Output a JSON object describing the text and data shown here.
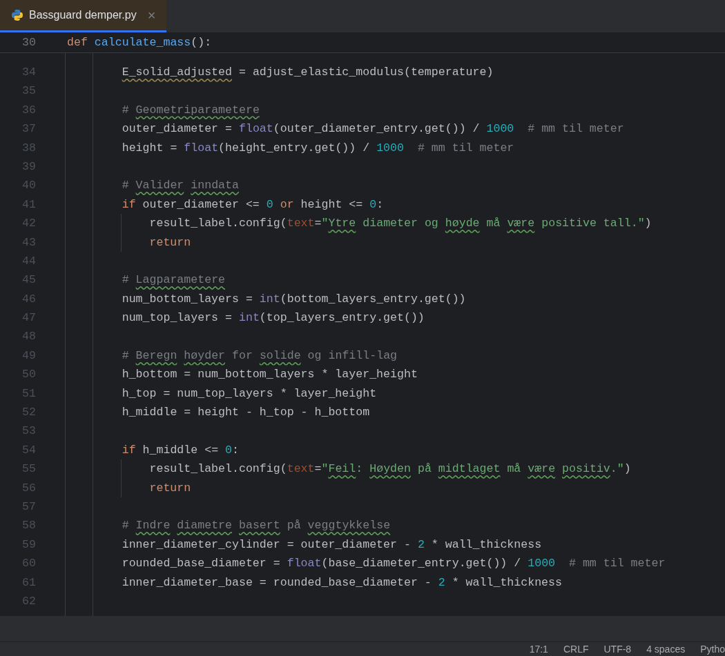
{
  "tabs": [
    {
      "label": "Bassguard demper.py",
      "close": "×",
      "selected": true
    }
  ],
  "sticky_header": {
    "number": "30",
    "tokens": [
      {
        "kind": "kw",
        "text": "def "
      },
      {
        "kind": "fn",
        "text": "calculate_mass"
      },
      {
        "kind": "plain",
        "text": "():"
      }
    ]
  },
  "lines": [
    {
      "number": "34",
      "tokens": [
        {
          "kind": "plain-warn",
          "text": "        E_solid_adjusted"
        },
        {
          "kind": "plain",
          "text": " = adjust_elastic_modulus(temperature)"
        }
      ]
    },
    {
      "number": "35"
    },
    {
      "number": "36",
      "tokens": [
        {
          "kind": "cmt",
          "text": "        # "
        },
        {
          "kind": "cmt-typo",
          "text": "Geometriparametere"
        }
      ]
    },
    {
      "number": "37",
      "tokens": [
        {
          "kind": "plain",
          "text": "        outer_diameter = "
        },
        {
          "kind": "builtin",
          "text": "float"
        },
        {
          "kind": "plain",
          "text": "(outer_diameter_entry.get()) / "
        },
        {
          "kind": "num",
          "text": "1000"
        },
        {
          "kind": "cmt",
          "text": "  # mm til meter"
        }
      ]
    },
    {
      "number": "38",
      "tokens": [
        {
          "kind": "plain",
          "text": "        height = "
        },
        {
          "kind": "builtin",
          "text": "float"
        },
        {
          "kind": "plain",
          "text": "(height_entry.get()) / "
        },
        {
          "kind": "num",
          "text": "1000"
        },
        {
          "kind": "cmt",
          "text": "  # mm til meter"
        }
      ]
    },
    {
      "number": "39"
    },
    {
      "number": "40",
      "tokens": [
        {
          "kind": "cmt",
          "text": "        # "
        },
        {
          "kind": "cmt-typo",
          "text": "Valider"
        },
        {
          "kind": "cmt-typo",
          "text": " inndata"
        }
      ]
    },
    {
      "number": "41",
      "tokens": [
        {
          "kind": "kw",
          "text": "        if "
        },
        {
          "kind": "plain",
          "text": "outer_diameter <= "
        },
        {
          "kind": "num",
          "text": "0"
        },
        {
          "kind": "kw",
          "text": " or "
        },
        {
          "kind": "plain",
          "text": "height <= "
        },
        {
          "kind": "num",
          "text": "0"
        },
        {
          "kind": "plain",
          "text": ":"
        }
      ]
    },
    {
      "number": "42",
      "tokens": [
        {
          "kind": "plain",
          "text": "            result_label.config("
        },
        {
          "kind": "param",
          "text": "text"
        },
        {
          "kind": "plain",
          "text": "="
        },
        {
          "kind": "str",
          "text": "\""
        },
        {
          "kind": "str-typo",
          "text": "Ytre"
        },
        {
          "kind": "str",
          "text": " diameter og "
        },
        {
          "kind": "str-typo",
          "text": "høyde"
        },
        {
          "kind": "str",
          "text": " må "
        },
        {
          "kind": "str-typo",
          "text": "være"
        },
        {
          "kind": "str",
          "text": " positive tall.\""
        },
        {
          "kind": "plain",
          "text": ")"
        }
      ]
    },
    {
      "number": "43",
      "tokens": [
        {
          "kind": "kw",
          "text": "            return"
        }
      ]
    },
    {
      "number": "44"
    },
    {
      "number": "45",
      "tokens": [
        {
          "kind": "cmt",
          "text": "        # "
        },
        {
          "kind": "cmt-typo",
          "text": "Lagparametere"
        }
      ]
    },
    {
      "number": "46",
      "tokens": [
        {
          "kind": "plain",
          "text": "        num_bottom_layers = "
        },
        {
          "kind": "builtin",
          "text": "int"
        },
        {
          "kind": "plain",
          "text": "(bottom_layers_entry.get())"
        }
      ]
    },
    {
      "number": "47",
      "tokens": [
        {
          "kind": "plain",
          "text": "        num_top_layers = "
        },
        {
          "kind": "builtin",
          "text": "int"
        },
        {
          "kind": "plain",
          "text": "(top_layers_entry.get())"
        }
      ]
    },
    {
      "number": "48"
    },
    {
      "number": "49",
      "tokens": [
        {
          "kind": "cmt",
          "text": "        # "
        },
        {
          "kind": "cmt-typo",
          "text": "Beregn"
        },
        {
          "kind": "cmt-typo",
          "text": " høyder"
        },
        {
          "kind": "cmt",
          "text": " for "
        },
        {
          "kind": "cmt-typo",
          "text": "solide"
        },
        {
          "kind": "cmt",
          "text": " og infill-lag"
        }
      ]
    },
    {
      "number": "50",
      "tokens": [
        {
          "kind": "plain",
          "text": "        h_bottom = num_bottom_layers * layer_height"
        }
      ]
    },
    {
      "number": "51",
      "tokens": [
        {
          "kind": "plain",
          "text": "        h_top = num_top_layers * layer_height"
        }
      ]
    },
    {
      "number": "52",
      "tokens": [
        {
          "kind": "plain",
          "text": "        h_middle = height - h_top - h_bottom"
        }
      ]
    },
    {
      "number": "53"
    },
    {
      "number": "54",
      "tokens": [
        {
          "kind": "kw",
          "text": "        if "
        },
        {
          "kind": "plain",
          "text": "h_middle <= "
        },
        {
          "kind": "num",
          "text": "0"
        },
        {
          "kind": "plain",
          "text": ":"
        }
      ]
    },
    {
      "number": "55",
      "tokens": [
        {
          "kind": "plain",
          "text": "            result_label.config("
        },
        {
          "kind": "param",
          "text": "text"
        },
        {
          "kind": "plain",
          "text": "="
        },
        {
          "kind": "str",
          "text": "\""
        },
        {
          "kind": "str-typo",
          "text": "Feil"
        },
        {
          "kind": "str",
          "text": ": "
        },
        {
          "kind": "str-typo",
          "text": "Høyden"
        },
        {
          "kind": "str",
          "text": " på "
        },
        {
          "kind": "str-typo",
          "text": "midtlaget"
        },
        {
          "kind": "str",
          "text": " må "
        },
        {
          "kind": "str-typo",
          "text": "være"
        },
        {
          "kind": "str-typo",
          "text": " positiv"
        },
        {
          "kind": "str",
          "text": ".\""
        },
        {
          "kind": "plain",
          "text": ")"
        }
      ]
    },
    {
      "number": "56",
      "tokens": [
        {
          "kind": "kw",
          "text": "            return"
        }
      ]
    },
    {
      "number": "57"
    },
    {
      "number": "58",
      "tokens": [
        {
          "kind": "cmt",
          "text": "        # "
        },
        {
          "kind": "cmt-typo",
          "text": "Indre"
        },
        {
          "kind": "cmt-typo",
          "text": " diametre"
        },
        {
          "kind": "cmt-typo",
          "text": " basert"
        },
        {
          "kind": "cmt",
          "text": " på "
        },
        {
          "kind": "cmt-typo",
          "text": "veggtykkelse"
        }
      ]
    },
    {
      "number": "59",
      "tokens": [
        {
          "kind": "plain",
          "text": "        inner_diameter_cylinder = outer_diameter - "
        },
        {
          "kind": "num",
          "text": "2"
        },
        {
          "kind": "plain",
          "text": " * wall_thickness"
        }
      ]
    },
    {
      "number": "60",
      "tokens": [
        {
          "kind": "plain",
          "text": "        rounded_base_diameter = "
        },
        {
          "kind": "builtin",
          "text": "float"
        },
        {
          "kind": "plain",
          "text": "(base_diameter_entry.get()) / "
        },
        {
          "kind": "num",
          "text": "1000"
        },
        {
          "kind": "cmt",
          "text": "  # mm til meter"
        }
      ]
    },
    {
      "number": "61",
      "tokens": [
        {
          "kind": "plain",
          "text": "        inner_diameter_base = rounded_base_diameter - "
        },
        {
          "kind": "num",
          "text": "2"
        },
        {
          "kind": "plain",
          "text": " * wall_thickness"
        }
      ]
    },
    {
      "number": "62"
    }
  ],
  "status_bar": [
    "17:1",
    "CRLF",
    "UTF-8",
    "4 spaces",
    "Pytho"
  ]
}
